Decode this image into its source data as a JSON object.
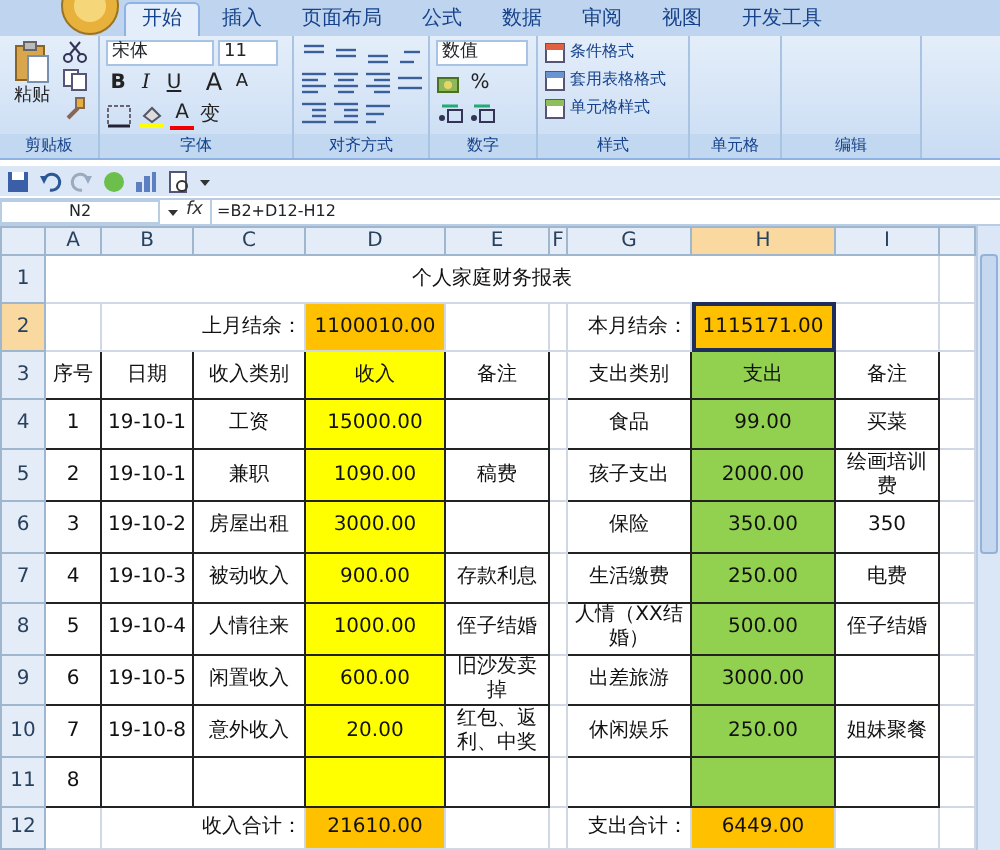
{
  "ribbon": {
    "tabs": [
      {
        "label": "开始",
        "selected": true
      },
      {
        "label": "插入",
        "selected": false
      },
      {
        "label": "页面布局",
        "selected": false
      },
      {
        "label": "公式",
        "selected": false
      },
      {
        "label": "数据",
        "selected": false
      },
      {
        "label": "审阅",
        "selected": false
      },
      {
        "label": "视图",
        "selected": false
      },
      {
        "label": "开发工具",
        "selected": false
      }
    ],
    "groups": [
      "剪贴板",
      "字体",
      "对齐方式",
      "数字",
      "样式",
      "单元格",
      "编辑"
    ],
    "clipboard": {
      "paste": "粘贴"
    },
    "font": {
      "name": "宋体",
      "size": "11",
      "bold": "B",
      "italic": "I",
      "underline": "U",
      "grow": "A",
      "shrink": "A",
      "font_color": "A",
      "phonetic": "变"
    },
    "number": {
      "format": "数值",
      "percent": "%"
    },
    "styles": [
      "条件格式",
      "套用表格格式",
      "单元格样式"
    ]
  },
  "formula_bar": {
    "name_box": "N2",
    "fx": "fx",
    "formula": "=B2+D12-H12"
  },
  "sheet": {
    "columns": [
      {
        "label": "A",
        "selected": false
      },
      {
        "label": "B",
        "selected": false
      },
      {
        "label": "C",
        "selected": false
      },
      {
        "label": "D",
        "selected": false
      },
      {
        "label": "E",
        "selected": false
      },
      {
        "label": "F",
        "selected": false
      },
      {
        "label": "G",
        "selected": false
      },
      {
        "label": "H",
        "selected": true
      },
      {
        "label": "I",
        "selected": false
      }
    ],
    "row_numbers": [
      {
        "label": "1",
        "selected": false
      },
      {
        "label": "2",
        "selected": true
      },
      {
        "label": "3",
        "selected": false
      },
      {
        "label": "4",
        "selected": false
      },
      {
        "label": "5",
        "selected": false
      },
      {
        "label": "6",
        "selected": false
      },
      {
        "label": "7",
        "selected": false
      },
      {
        "label": "8",
        "selected": false
      },
      {
        "label": "9",
        "selected": false
      },
      {
        "label": "10",
        "selected": false
      },
      {
        "label": "11",
        "selected": false
      },
      {
        "label": "12",
        "selected": false
      }
    ],
    "title": "个人家庭财务报表",
    "last_month": {
      "label": "上月结余：",
      "value": "1100010.00"
    },
    "this_month": {
      "label": "本月结余：",
      "value": "1115171.00",
      "selected": true
    },
    "income_headers": [
      "序号",
      "日期",
      "收入类别",
      "收入",
      "备注"
    ],
    "expense_headers": [
      "支出类别",
      "支出",
      "备注"
    ],
    "income": [
      {
        "no": "1",
        "date": "19-10-1",
        "category": "工资",
        "amount": "15000.00"
      },
      {
        "no": "2",
        "date": "19-10-1",
        "category": "兼职",
        "amount": "1090.00",
        "note": "稿费"
      },
      {
        "no": "3",
        "date": "19-10-2",
        "category": "房屋出租",
        "amount": "3000.00"
      },
      {
        "no": "4",
        "date": "19-10-3",
        "category": "被动收入",
        "amount": "900.00",
        "note": "存款利息"
      },
      {
        "no": "5",
        "date": "19-10-4",
        "category": "人情往来",
        "amount": "1000.00",
        "note": "侄子结婚"
      },
      {
        "no": "6",
        "date": "19-10-5",
        "category": "闲置收入",
        "amount": "600.00",
        "note": "旧沙发卖掉"
      },
      {
        "no": "7",
        "date": "19-10-8",
        "category": "意外收入",
        "amount": "20.00",
        "note": "红包、返利、中奖"
      },
      {
        "no": "8"
      }
    ],
    "expense": [
      {
        "category": "食品",
        "amount": "99.00",
        "note": "买菜"
      },
      {
        "category": "孩子支出",
        "amount": "2000.00",
        "note": "绘画培训费"
      },
      {
        "category": "保险",
        "amount": "350.00",
        "note": "350"
      },
      {
        "category": "生活缴费",
        "amount": "250.00",
        "note": "电费"
      },
      {
        "category": "人情（XX结婚）",
        "amount": "500.00",
        "note": "侄子结婚"
      },
      {
        "category": "出差旅游",
        "amount": "3000.00"
      },
      {
        "category": "休闲娱乐",
        "amount": "250.00",
        "note": "姐妹聚餐"
      }
    ],
    "income_total": {
      "label": "收入合计：",
      "value": "21610.00"
    },
    "expense_total": {
      "label": "支出合计：",
      "value": "6449.00"
    }
  }
}
